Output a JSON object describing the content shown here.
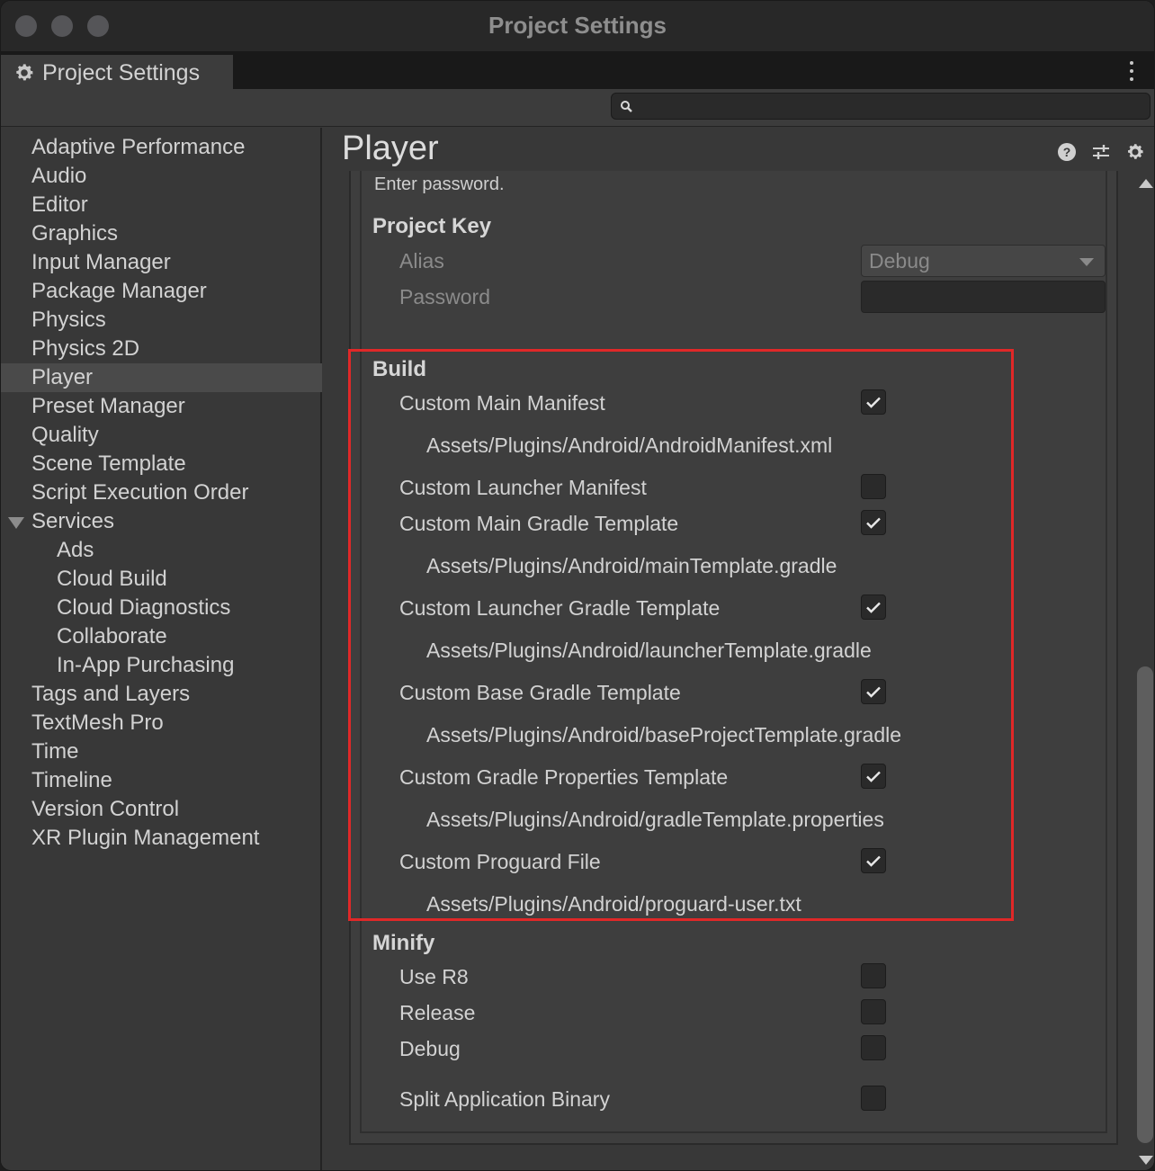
{
  "window": {
    "title": "Project Settings"
  },
  "tab": {
    "label": "Project Settings",
    "icon": "gear-icon"
  },
  "search": {
    "placeholder": "",
    "value": ""
  },
  "sidebar": {
    "items": [
      "Adaptive Performance",
      "Audio",
      "Editor",
      "Graphics",
      "Input Manager",
      "Package Manager",
      "Physics",
      "Physics 2D",
      "Player",
      "Preset Manager",
      "Quality",
      "Scene Template",
      "Script Execution Order",
      "Services",
      "Ads",
      "Cloud Build",
      "Cloud Diagnostics",
      "Collaborate",
      "In-App Purchasing",
      "Tags and Layers",
      "TextMesh Pro",
      "Time",
      "Timeline",
      "Version Control",
      "XR Plugin Management"
    ],
    "selected": "Player"
  },
  "panel": {
    "title": "Player",
    "hint": "Enter password.",
    "project_key": {
      "heading": "Project Key",
      "alias_label": "Alias",
      "alias_value": "Debug",
      "password_label": "Password"
    },
    "build": {
      "heading": "Build",
      "rows": [
        {
          "label": "Custom Main Manifest",
          "checked": true,
          "path": "Assets/Plugins/Android/AndroidManifest.xml"
        },
        {
          "label": "Custom Launcher Manifest",
          "checked": false,
          "path": ""
        },
        {
          "label": "Custom Main Gradle Template",
          "checked": true,
          "path": "Assets/Plugins/Android/mainTemplate.gradle"
        },
        {
          "label": "Custom Launcher Gradle Template",
          "checked": true,
          "path": "Assets/Plugins/Android/launcherTemplate.gradle"
        },
        {
          "label": "Custom Base Gradle Template",
          "checked": true,
          "path": "Assets/Plugins/Android/baseProjectTemplate.gradle"
        },
        {
          "label": "Custom Gradle Properties Template",
          "checked": true,
          "path": "Assets/Plugins/Android/gradleTemplate.properties"
        },
        {
          "label": "Custom Proguard File",
          "checked": true,
          "path": "Assets/Plugins/Android/proguard-user.txt"
        }
      ]
    },
    "minify": {
      "heading": "Minify",
      "rows": [
        {
          "label": "Use R8",
          "checked": false
        },
        {
          "label": "Release",
          "checked": false
        },
        {
          "label": "Debug",
          "checked": false
        }
      ]
    },
    "split": {
      "label": "Split Application Binary",
      "checked": false
    }
  },
  "colors": {
    "highlight": "#e02828",
    "background": "#383838"
  }
}
